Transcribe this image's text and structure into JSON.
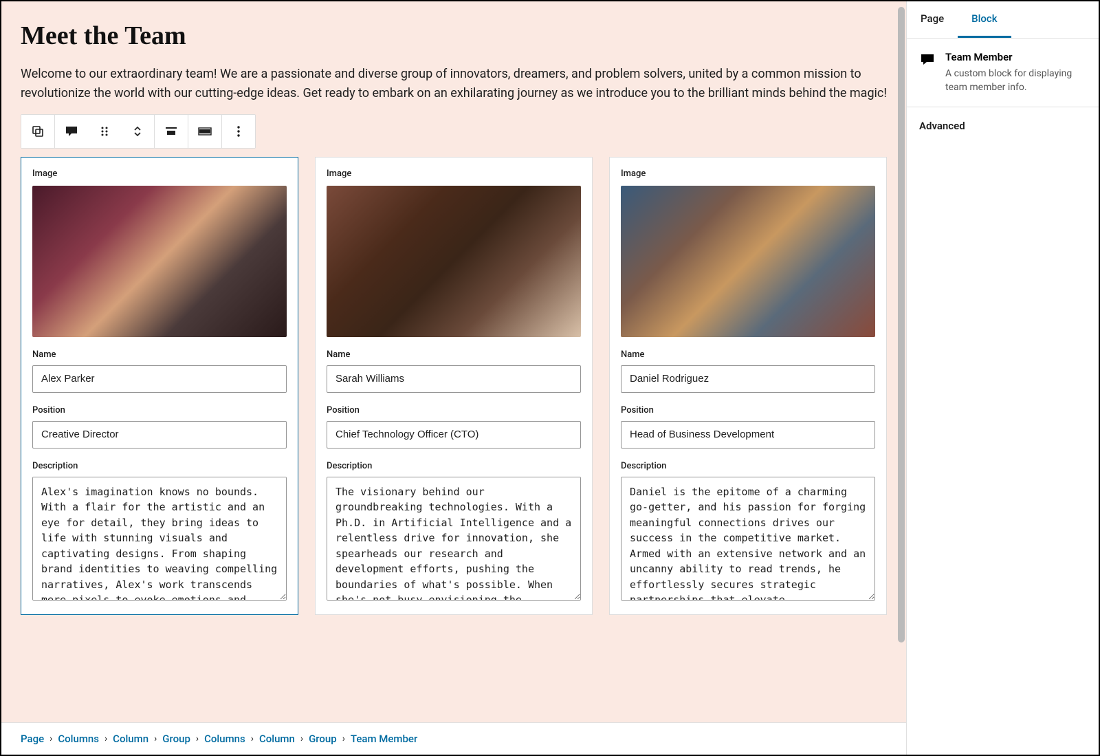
{
  "page": {
    "title": "Meet the Team",
    "intro": "Welcome to our extraordinary team! We are a passionate and diverse group of innovators, dreamers, and problem solvers, united by a common mission to revolutionize the world with our cutting-edge ideas. Get ready to embark on an exhilarating journey as we introduce you to the brilliant minds behind the magic!"
  },
  "labels": {
    "image": "Image",
    "name": "Name",
    "position": "Position",
    "description": "Description"
  },
  "team": [
    {
      "name": "Alex Parker",
      "position": "Creative Director",
      "description": "Alex's imagination knows no bounds. With a flair for the artistic and an eye for detail, they bring ideas to life with stunning visuals and captivating designs. From shaping brand identities to weaving compelling narratives, Alex's work transcends mere pixels to evoke emotions and"
    },
    {
      "name": "Sarah Williams",
      "position": "Chief Technology Officer (CTO)",
      "description": "The visionary behind our groundbreaking technologies. With a Ph.D. in Artificial Intelligence and a relentless drive for innovation, she spearheads our research and development efforts, pushing the boundaries of what's possible. When she's not busy envisioning the"
    },
    {
      "name": "Daniel Rodriguez",
      "position": "Head of Business Development",
      "description": "Daniel is the epitome of a charming go-getter, and his passion for forging meaningful connections drives our success in the competitive market. Armed with an extensive network and an uncanny ability to read trends, he effortlessly secures strategic partnerships that elevate"
    }
  ],
  "breadcrumb": [
    "Page",
    "Columns",
    "Column",
    "Group",
    "Columns",
    "Column",
    "Group",
    "Team Member"
  ],
  "sidebar": {
    "tabs": {
      "page": "Page",
      "block": "Block"
    },
    "block_title": "Team Member",
    "block_desc": "A custom block for displaying team member info.",
    "advanced": "Advanced"
  }
}
